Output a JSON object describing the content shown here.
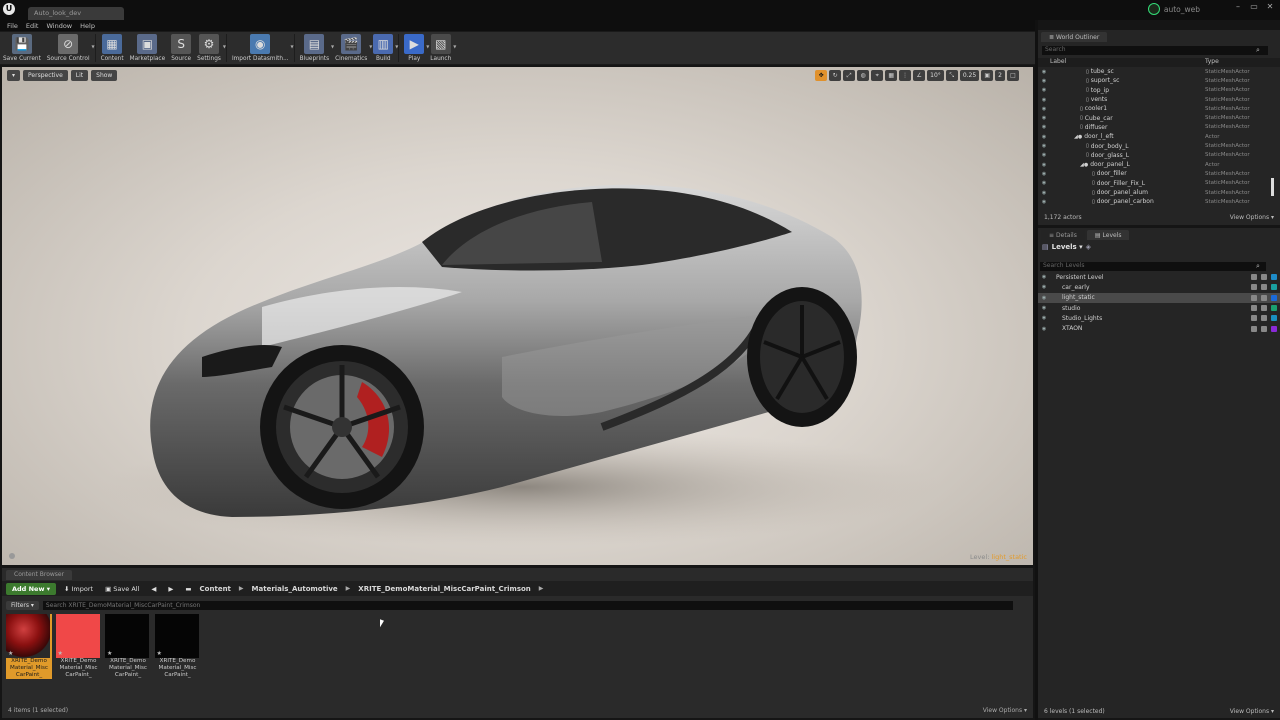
{
  "window": {
    "doc_tab": "Auto_look_dev",
    "project_name": "auto_web",
    "controls": [
      "–",
      "▭",
      "✕"
    ]
  },
  "menu": [
    "File",
    "Edit",
    "Window",
    "Help"
  ],
  "toolbar": [
    {
      "name": "save-current",
      "label": "Save Current",
      "icon": "save-icon",
      "glyph": "💾",
      "color": "#5a6a80"
    },
    {
      "name": "source-control",
      "label": "Source Control",
      "icon": "source-control-icon",
      "glyph": "⊘",
      "color": "#6a6a6a",
      "dropdown": true
    },
    {
      "name": "content",
      "label": "Content",
      "icon": "content-icon",
      "glyph": "▦",
      "color": "#4a6a9a"
    },
    {
      "name": "marketplace",
      "label": "Marketplace",
      "icon": "marketplace-icon",
      "glyph": "▣",
      "color": "#5a6a8a"
    },
    {
      "name": "source",
      "label": "Source",
      "icon": "source-icon",
      "glyph": "S",
      "color": "#555"
    },
    {
      "name": "settings",
      "label": "Settings",
      "icon": "settings-icon",
      "glyph": "⚙",
      "color": "#555",
      "dropdown": true
    },
    {
      "name": "import-datasmith",
      "label": "Import Datasmith...",
      "icon": "datasmith-icon",
      "glyph": "◉",
      "color": "#4a7ab0",
      "dropdown": true
    },
    {
      "name": "blueprints",
      "label": "Blueprints",
      "icon": "blueprints-icon",
      "glyph": "▤",
      "color": "#5a6a8a",
      "dropdown": true
    },
    {
      "name": "cinematics",
      "label": "Cinematics",
      "icon": "cinematics-icon",
      "glyph": "🎬",
      "color": "#5a6a8a",
      "dropdown": true
    },
    {
      "name": "build",
      "label": "Build",
      "icon": "build-icon",
      "glyph": "▥",
      "color": "#4a6ab0",
      "dropdown": true
    },
    {
      "name": "play",
      "label": "Play",
      "icon": "play-icon",
      "glyph": "▶",
      "color": "#3a6ac8",
      "dropdown": true
    },
    {
      "name": "launch",
      "label": "Launch",
      "icon": "launch-icon",
      "glyph": "▧",
      "color": "#4a4a4a",
      "dropdown": true
    }
  ],
  "viewport": {
    "perspective": "Perspective",
    "lit": "Lit",
    "show": "Show",
    "grid_value": "10°",
    "scale_value": "0.25",
    "camera_speed": "2",
    "level_label": "Level:",
    "level_name": "light_static"
  },
  "content_browser": {
    "tab": "Content Browser",
    "add_new": "Add New ▾",
    "import": "Import",
    "save_all": "Save All",
    "path": [
      "Content",
      "Materials_Automotive",
      "XRITE_DemoMaterial_MiscCarPaint_Crimson"
    ],
    "filters": "Filters ▾",
    "search_placeholder": "Search XRITE_DemoMaterial_MiscCarPaint_Crimson",
    "assets": [
      {
        "label": "XRITE_Demo Material_Misc CarPaint_",
        "kind": "sphere",
        "selected": true
      },
      {
        "label": "XRITE_Demo Material_Misc CarPaint_",
        "kind": "red",
        "selected": false
      },
      {
        "label": "XRITE_Demo Material_Misc CarPaint_",
        "kind": "black",
        "selected": false
      },
      {
        "label": "XRITE_Demo Material_Misc CarPaint_",
        "kind": "black",
        "selected": false
      }
    ],
    "status": "4 items (1 selected)",
    "view_options": "View Options ▾"
  },
  "outliner": {
    "tab": "World Outliner",
    "search_placeholder": "Search",
    "col_label": "Label",
    "col_type": "Type",
    "rows": [
      {
        "label": "tube_sc",
        "type": "StaticMeshActor",
        "indent": 6
      },
      {
        "label": "suport_sc",
        "type": "StaticMeshActor",
        "indent": 6
      },
      {
        "label": "top_ip",
        "type": "StaticMeshActor",
        "indent": 6
      },
      {
        "label": "vents",
        "type": "StaticMeshActor",
        "indent": 6
      },
      {
        "label": "cooler1",
        "type": "StaticMeshActor",
        "indent": 5
      },
      {
        "label": "Cube_car",
        "type": "StaticMeshActor",
        "indent": 5
      },
      {
        "label": "diffuser",
        "type": "StaticMeshActor",
        "indent": 5
      },
      {
        "label": "door_l_eft",
        "type": "Actor",
        "indent": 4,
        "group": true
      },
      {
        "label": "door_body_L",
        "type": "StaticMeshActor",
        "indent": 6
      },
      {
        "label": "door_glass_L",
        "type": "StaticMeshActor",
        "indent": 6
      },
      {
        "label": "door_panel_L",
        "type": "Actor",
        "indent": 5,
        "group": true
      },
      {
        "label": "door_filler",
        "type": "StaticMeshActor",
        "indent": 7
      },
      {
        "label": "door_Filler_Fix_L",
        "type": "StaticMeshActor",
        "indent": 7
      },
      {
        "label": "door_panel_alum",
        "type": "StaticMeshActor",
        "indent": 7
      },
      {
        "label": "door_panel_carbon",
        "type": "StaticMeshActor",
        "indent": 7
      }
    ],
    "count": "1,172 actors",
    "view_options": "View Options ▾"
  },
  "levels": {
    "tab_details": "Details",
    "tab_levels": "Levels",
    "header": "Levels ▾",
    "search_placeholder": "Search Levels",
    "rows": [
      {
        "label": "Persistent Level",
        "indent": 1,
        "color": "#1e8cc8",
        "selected": false
      },
      {
        "label": "car_early",
        "indent": 2,
        "color": "#1aa0a0",
        "selected": false
      },
      {
        "label": "light_static",
        "indent": 2,
        "color": "#1a6ad8",
        "selected": true
      },
      {
        "label": "studio",
        "indent": 2,
        "color": "#1aa070",
        "selected": false
      },
      {
        "label": "Studio_Lights",
        "indent": 2,
        "color": "#1a90c0",
        "selected": false
      },
      {
        "label": "XTAON",
        "indent": 2,
        "color": "#8a2ad8",
        "selected": false
      }
    ],
    "status": "6 levels (1 selected)",
    "view_options": "View Options ▾"
  }
}
